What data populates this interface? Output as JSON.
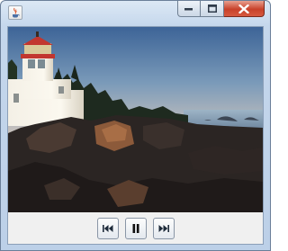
{
  "window": {
    "title": "",
    "buttons": {
      "minimize": "minimize-icon",
      "maximize": "maximize-icon",
      "close": "close-icon"
    }
  },
  "video": {
    "content": "lighthouse-on-rocky-shore-at-sunset"
  },
  "controls": {
    "previous": "skip-back-icon",
    "play_pause": "pause-icon",
    "next": "skip-forward-icon"
  },
  "colors": {
    "close_button": "#c8412a",
    "title_bar": "#c5d7ec",
    "client_background": "#f0f0f0"
  }
}
